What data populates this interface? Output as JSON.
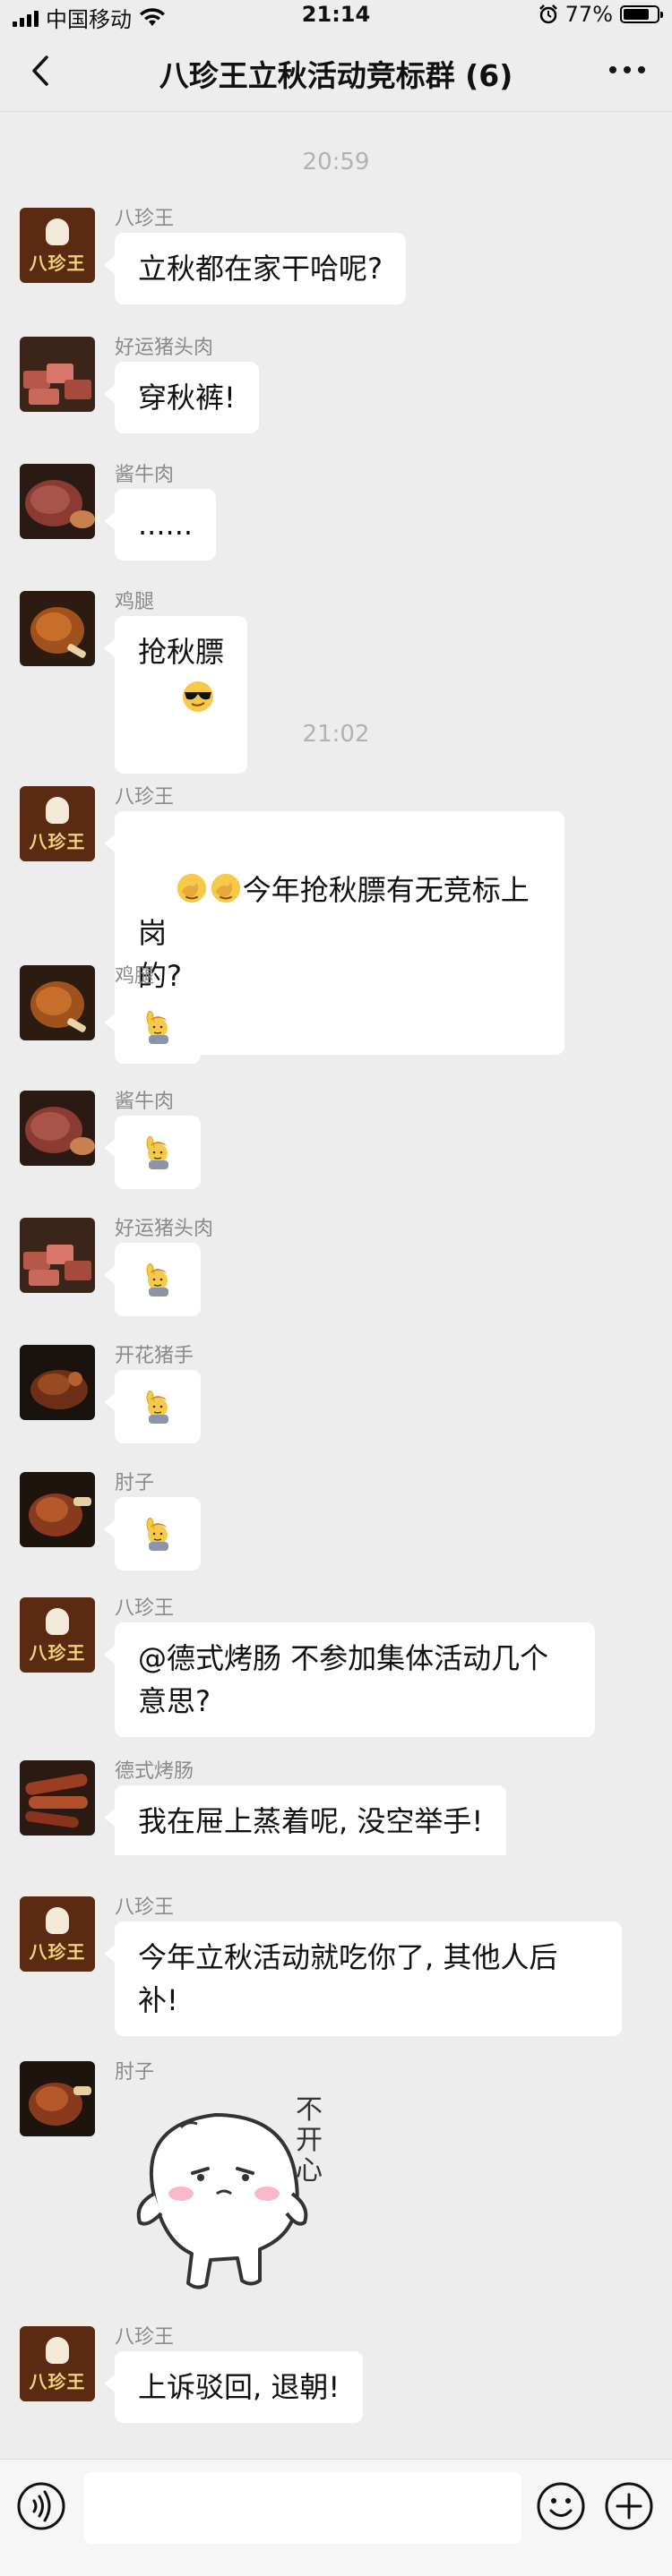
{
  "status_bar": {
    "carrier": "中国移动",
    "time": "21:14",
    "battery": "77%",
    "battery_level": 0.77
  },
  "header": {
    "title": "八珍王立秋活动竞标群 (6)",
    "back_icon": "chevron-left-icon",
    "more_icon": "more-dots-icon"
  },
  "timestamps": [
    "20:59",
    "21:02"
  ],
  "messages": [
    {
      "sender": "八珍王",
      "avatar": "bazhenwang-logo",
      "text": "立秋都在家干哈呢?"
    },
    {
      "sender": "好运猪头肉",
      "avatar": "pork-head-photo",
      "text": "穿秋裤!"
    },
    {
      "sender": "酱牛肉",
      "avatar": "beef-photo",
      "text": "......"
    },
    {
      "sender": "鸡腿",
      "avatar": "chicken-leg-photo",
      "text": "抢秋膘",
      "emoji": "sunglasses-emoji"
    },
    {
      "sender": "八珍王",
      "avatar": "bazhenwang-logo",
      "text": "今年抢秋膘有无竞标上岗\n的?",
      "emoji": "facepalm-emoji"
    },
    {
      "sender": "鸡腿",
      "avatar": "chicken-leg-photo",
      "emoji": "raising-hand-emoji"
    },
    {
      "sender": "酱牛肉",
      "avatar": "beef-photo",
      "emoji": "raising-hand-emoji"
    },
    {
      "sender": "好运猪头肉",
      "avatar": "pork-head-photo",
      "emoji": "raising-hand-emoji"
    },
    {
      "sender": "开花猪手",
      "avatar": "pork-trotter-photo",
      "emoji": "raising-hand-emoji"
    },
    {
      "sender": "肘子",
      "avatar": "pork-knuckle-photo",
      "emoji": "raising-hand-emoji"
    },
    {
      "sender": "八珍王",
      "avatar": "bazhenwang-logo",
      "text": "@德式烤肠 不参加集体活动几个\n意思?"
    },
    {
      "sender": "德式烤肠",
      "avatar": "sausage-photo",
      "text": "我在屉上蒸着呢, 没空举手!"
    },
    {
      "sender": "八珍王",
      "avatar": "bazhenwang-logo",
      "text": "今年立秋活动就吃你了, 其他人后\n补!"
    },
    {
      "sender": "肘子",
      "avatar": "pork-knuckle-photo",
      "sticker": "unhappy-bun-sticker",
      "sticker_text": "不开心"
    },
    {
      "sender": "八珍王",
      "avatar": "bazhenwang-logo",
      "text": "上诉驳回, 退朝!"
    }
  ],
  "logo_text": "八珍王",
  "input_bar": {
    "voice_icon": "voice-icon",
    "emoji_icon": "emoji-icon",
    "plus_icon": "plus-icon",
    "placeholder": ""
  }
}
